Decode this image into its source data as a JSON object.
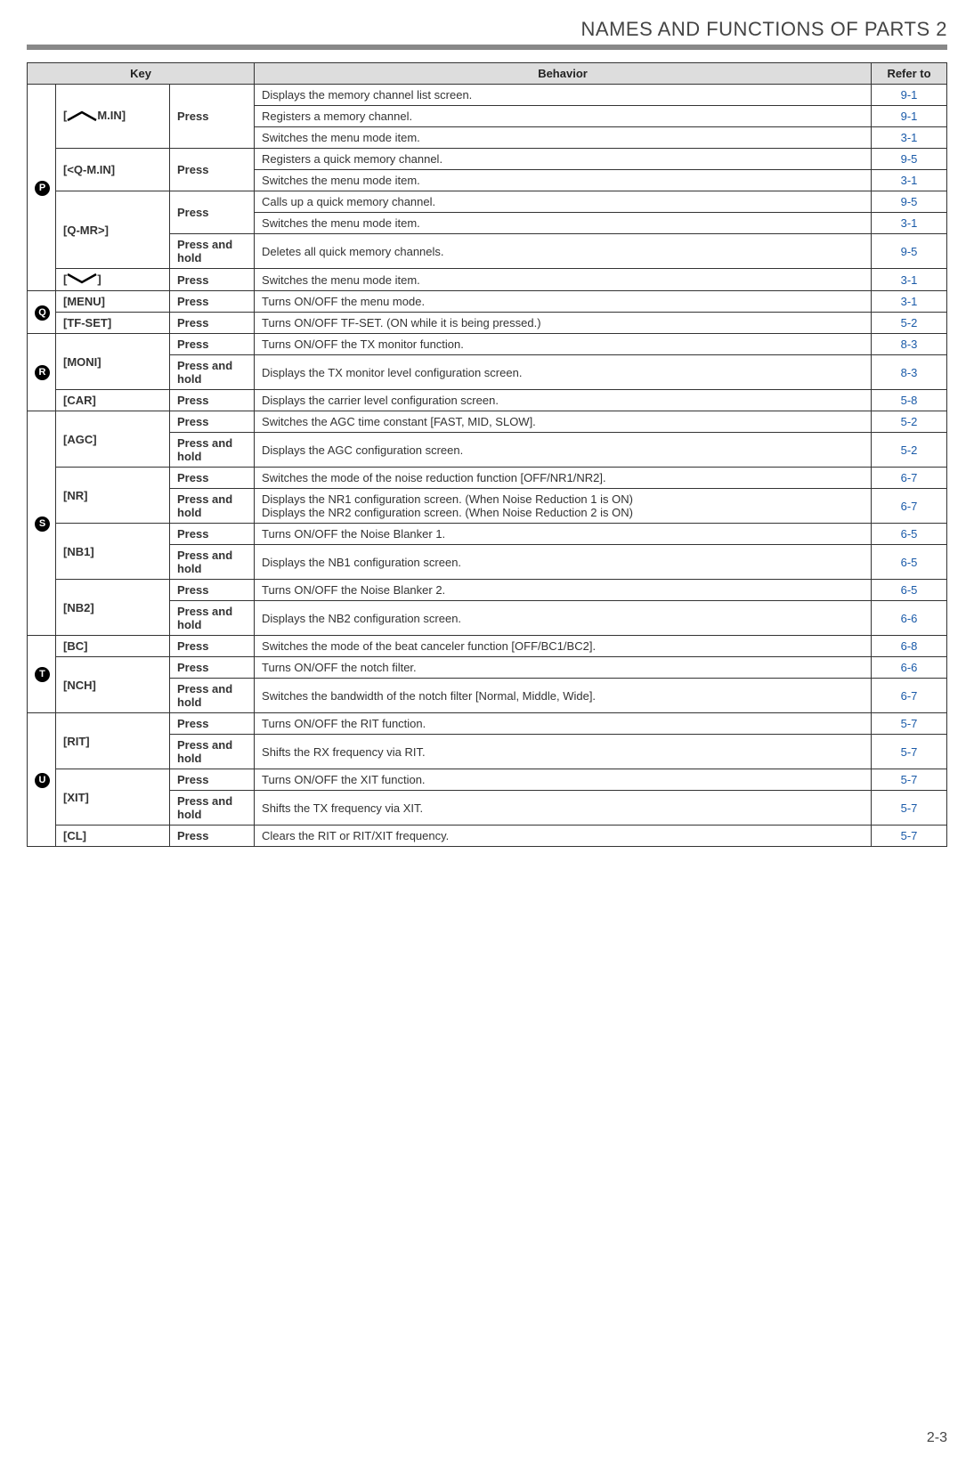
{
  "header": {
    "title": "NAMES AND FUNCTIONS OF PARTS  2"
  },
  "columns": {
    "key": "Key",
    "behavior": "Behavior",
    "refer": "Refer to"
  },
  "groups": [
    {
      "badge": "P",
      "keys": [
        {
          "label_prefix": "[",
          "label_icon": "up",
          "label_suffix": "M.IN]",
          "actions": [
            {
              "action": "Press",
              "rows": [
                {
                  "behavior": "Displays the memory channel list screen.",
                  "refer": "9-1"
                },
                {
                  "behavior": "Registers a memory channel.",
                  "refer": "9-1"
                },
                {
                  "behavior": "Switches the menu mode item.",
                  "refer": "3-1"
                }
              ]
            }
          ]
        },
        {
          "label": "[<Q-M.IN]",
          "actions": [
            {
              "action": "Press",
              "rows": [
                {
                  "behavior": "Registers a quick memory channel.",
                  "refer": "9-5"
                },
                {
                  "behavior": "Switches the menu mode item.",
                  "refer": "3-1"
                }
              ]
            }
          ]
        },
        {
          "label": "[Q-MR>]",
          "actions": [
            {
              "action": "Press",
              "rows": [
                {
                  "behavior": "Calls up a quick memory channel.",
                  "refer": "9-5"
                },
                {
                  "behavior": "Switches the menu mode item.",
                  "refer": "3-1"
                }
              ]
            },
            {
              "action": "Press and hold",
              "rows": [
                {
                  "behavior": "Deletes all quick memory channels.",
                  "refer": "9-5"
                }
              ]
            }
          ]
        },
        {
          "label_prefix": "[",
          "label_icon": "down",
          "label_suffix": "]",
          "actions": [
            {
              "action": "Press",
              "rows": [
                {
                  "behavior": "Switches the menu mode item.",
                  "refer": "3-1"
                }
              ]
            }
          ]
        }
      ]
    },
    {
      "badge": "Q",
      "keys": [
        {
          "label": "[MENU]",
          "actions": [
            {
              "action": "Press",
              "rows": [
                {
                  "behavior": "Turns ON/OFF the menu mode.",
                  "refer": "3-1"
                }
              ]
            }
          ]
        },
        {
          "label": "[TF-SET]",
          "actions": [
            {
              "action": "Press",
              "rows": [
                {
                  "behavior": "Turns ON/OFF TF-SET. (ON while it is being pressed.)",
                  "refer": "5-2"
                }
              ]
            }
          ]
        }
      ]
    },
    {
      "badge": "R",
      "keys": [
        {
          "label": "[MONI]",
          "actions": [
            {
              "action": "Press",
              "rows": [
                {
                  "behavior": "Turns ON/OFF the TX monitor function.",
                  "refer": "8-3"
                }
              ]
            },
            {
              "action": "Press and hold",
              "rows": [
                {
                  "behavior": "Displays the TX monitor level configuration screen.",
                  "refer": "8-3"
                }
              ]
            }
          ]
        },
        {
          "label": "[CAR]",
          "actions": [
            {
              "action": "Press",
              "rows": [
                {
                  "behavior": "Displays the carrier level configuration screen.",
                  "refer": "5-8"
                }
              ]
            }
          ]
        }
      ]
    },
    {
      "badge": "S",
      "keys": [
        {
          "label": "[AGC]",
          "actions": [
            {
              "action": "Press",
              "rows": [
                {
                  "behavior": "Switches the AGC time constant [FAST, MID, SLOW].",
                  "refer": "5-2"
                }
              ]
            },
            {
              "action": "Press and hold",
              "rows": [
                {
                  "behavior": "Displays the AGC configuration screen.",
                  "refer": "5-2"
                }
              ]
            }
          ]
        },
        {
          "label": "[NR]",
          "actions": [
            {
              "action": "Press",
              "rows": [
                {
                  "behavior": "Switches the mode of the noise reduction function [OFF/NR1/NR2].",
                  "refer": "6-7"
                }
              ]
            },
            {
              "action": "Press and hold",
              "rows": [
                {
                  "behavior": "Displays the NR1 configuration screen. (When Noise Reduction 1 is ON)\nDisplays the NR2 configuration screen. (When Noise Reduction 2 is ON)",
                  "refer": "6-7"
                }
              ]
            }
          ]
        },
        {
          "label": "[NB1]",
          "actions": [
            {
              "action": "Press",
              "rows": [
                {
                  "behavior": "Turns ON/OFF the Noise Blanker 1.",
                  "refer": "6-5"
                }
              ]
            },
            {
              "action": "Press and hold",
              "rows": [
                {
                  "behavior": "Displays the NB1 configuration screen.",
                  "refer": "6-5"
                }
              ]
            }
          ]
        },
        {
          "label": "[NB2]",
          "actions": [
            {
              "action": "Press",
              "rows": [
                {
                  "behavior": "Turns ON/OFF the Noise Blanker 2.",
                  "refer": "6-5"
                }
              ]
            },
            {
              "action": "Press and hold",
              "rows": [
                {
                  "behavior": "Displays the NB2 configuration screen.",
                  "refer": "6-6"
                }
              ]
            }
          ]
        }
      ]
    },
    {
      "badge": "T",
      "keys": [
        {
          "label": "[BC]",
          "actions": [
            {
              "action": "Press",
              "rows": [
                {
                  "behavior": "Switches the mode of the beat canceler function [OFF/BC1/BC2].",
                  "refer": "6-8"
                }
              ]
            }
          ]
        },
        {
          "label": "[NCH]",
          "actions": [
            {
              "action": "Press",
              "rows": [
                {
                  "behavior": "Turns ON/OFF the notch filter.",
                  "refer": "6-6"
                }
              ]
            },
            {
              "action": "Press and hold",
              "rows": [
                {
                  "behavior": "Switches the bandwidth of the notch filter [Normal, Middle, Wide].",
                  "refer": "6-7"
                }
              ]
            }
          ]
        }
      ]
    },
    {
      "badge": "U",
      "keys": [
        {
          "label": "[RIT]",
          "actions": [
            {
              "action": "Press",
              "rows": [
                {
                  "behavior": "Turns ON/OFF the RIT function.",
                  "refer": "5-7"
                }
              ]
            },
            {
              "action": "Press and hold",
              "rows": [
                {
                  "behavior": "Shifts the RX frequency via RIT.",
                  "refer": "5-7"
                }
              ]
            }
          ]
        },
        {
          "label": "[XIT]",
          "actions": [
            {
              "action": "Press",
              "rows": [
                {
                  "behavior": "Turns ON/OFF the XIT function.",
                  "refer": "5-7"
                }
              ]
            },
            {
              "action": "Press and hold",
              "rows": [
                {
                  "behavior": "Shifts the TX frequency via XIT.",
                  "refer": "5-7"
                }
              ]
            }
          ]
        },
        {
          "label": "[CL]",
          "actions": [
            {
              "action": "Press",
              "rows": [
                {
                  "behavior": "Clears the RIT or RIT/XIT frequency.",
                  "refer": "5-7"
                }
              ]
            }
          ]
        }
      ]
    }
  ],
  "page_number": "2-3"
}
